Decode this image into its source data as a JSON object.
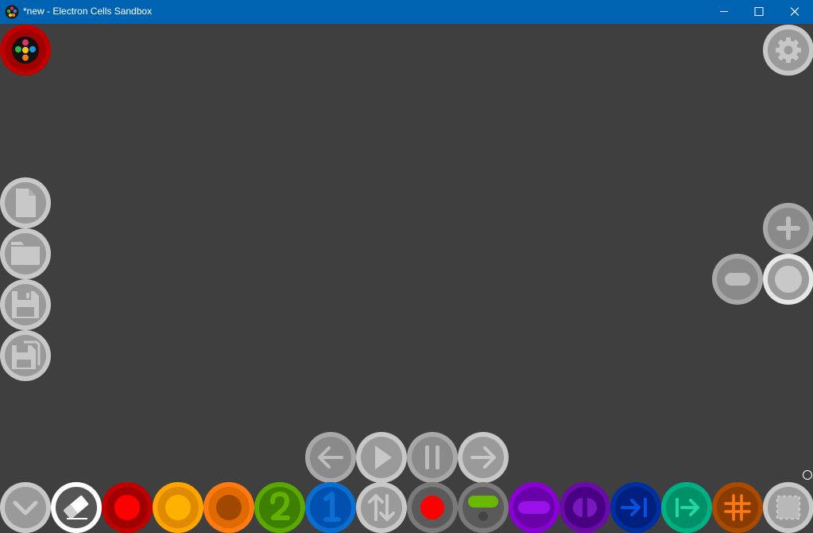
{
  "window": {
    "title": "*new - Electron Cells Sandbox",
    "app_icon": "electron-cells-icon",
    "controls": {
      "minimize": "—",
      "maximize": "☐",
      "close": "✕"
    }
  },
  "colors": {
    "background": "#3f3f3f",
    "titlebar": "#0063b1",
    "button_ring": "#c8c8c8",
    "button_fill": "#9a9a9a"
  },
  "toolbar": {
    "main_menu": "palette-menu-icon",
    "settings": "gear-icon",
    "file": [
      "new-file-icon",
      "open-folder-icon",
      "save-icon",
      "save-as-icon"
    ],
    "zoom": [
      "zoom-in-icon",
      "zoom-out-icon",
      "zoom-reset-icon"
    ],
    "playback": [
      "step-back-icon",
      "play-icon",
      "pause-icon",
      "step-forward-icon"
    ],
    "palette": [
      "collapse-chevron-icon",
      "eraser-icon",
      "red-cell-icon",
      "yellow-cell-icon",
      "orange-cell-icon",
      "green-two-cell-icon",
      "blue-one-cell-icon",
      "swap-arrows-icon",
      "red-record-icon",
      "green-switch-icon",
      "purple-bar-icon",
      "purple-split-icon",
      "blue-arrow-stop-icon",
      "teal-arrow-in-icon",
      "orange-hash-icon",
      "selection-icon"
    ]
  }
}
